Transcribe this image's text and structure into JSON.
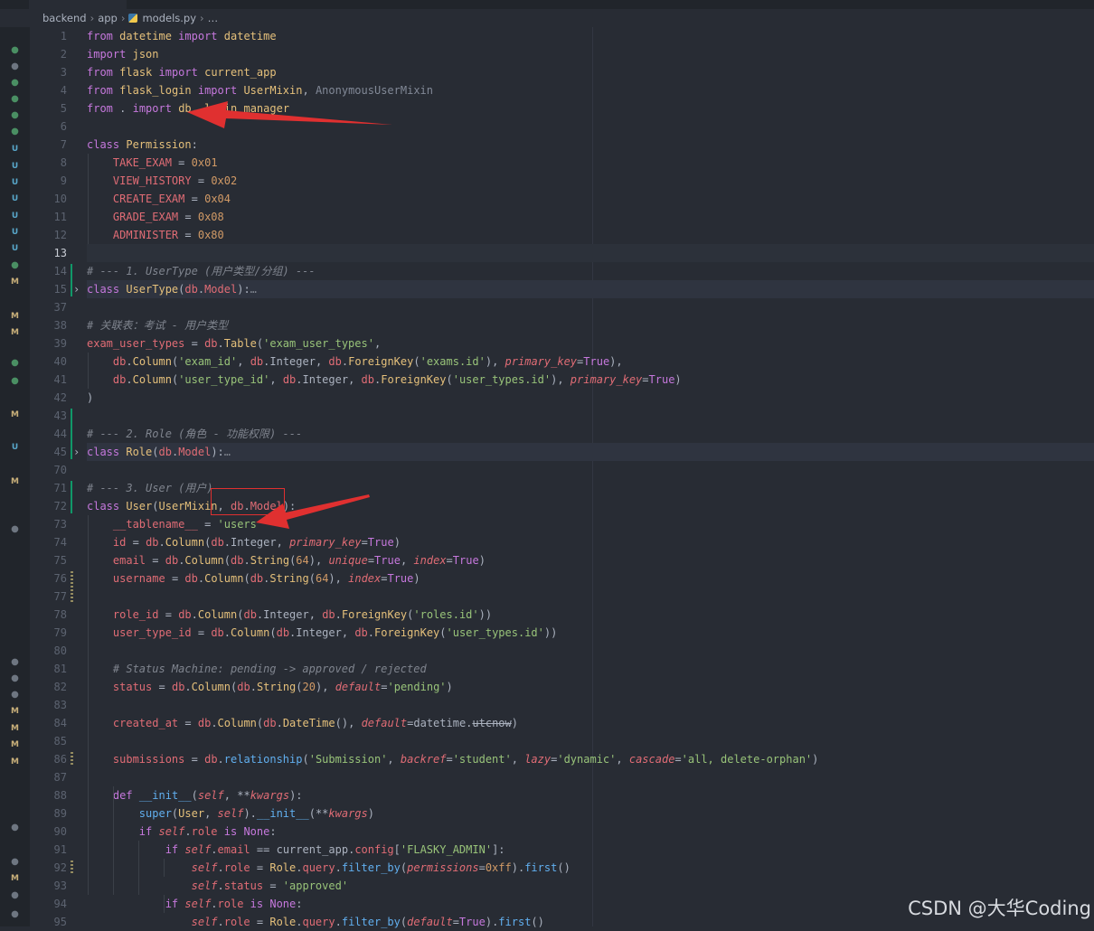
{
  "breadcrumb": {
    "parts": [
      "backend",
      "app",
      "models.py",
      "…"
    ]
  },
  "scm_markers": [
    {
      "text": "●",
      "color": "#4a8f63"
    },
    {
      "text": "●",
      "color": "#6e7681"
    },
    {
      "text": "●",
      "color": "#4a8f63"
    },
    {
      "text": "●",
      "color": "#4a8f63"
    },
    {
      "text": "●",
      "color": "#4a8f63"
    },
    {
      "text": "●",
      "color": "#4a8f63"
    },
    {
      "text": "U",
      "color": "#58a6c9"
    },
    {
      "text": "U",
      "color": "#58a6c9"
    },
    {
      "text": "U",
      "color": "#58a6c9"
    },
    {
      "text": "U",
      "color": "#58a6c9"
    },
    {
      "text": "U",
      "color": "#58a6c9"
    },
    {
      "text": "U",
      "color": "#58a6c9"
    },
    {
      "text": "U",
      "color": "#58a6c9"
    },
    {
      "text": "●",
      "color": "#4a8f63"
    },
    {
      "text": "M",
      "color": "#c9b07a"
    },
    {
      "text": "M",
      "color": "#c9b07a"
    },
    {
      "text": "M",
      "color": "#c9b07a"
    },
    {
      "text": "●",
      "color": "#4a8f63"
    },
    {
      "text": "●",
      "color": "#4a8f63"
    },
    {
      "text": "M",
      "color": "#c9b07a"
    },
    {
      "text": "U",
      "color": "#58a6c9"
    },
    {
      "text": "M",
      "color": "#c9b07a"
    },
    {
      "text": "●",
      "color": "#6e7681"
    },
    {
      "text": "●",
      "color": "#6e7681"
    },
    {
      "text": "●",
      "color": "#6e7681"
    },
    {
      "text": "●",
      "color": "#6e7681"
    },
    {
      "text": "M",
      "color": "#c9b07a"
    },
    {
      "text": "M",
      "color": "#c9b07a"
    },
    {
      "text": "M",
      "color": "#c9b07a"
    },
    {
      "text": "M",
      "color": "#c9b07a"
    },
    {
      "text": "●",
      "color": "#6e7681"
    },
    {
      "text": "●",
      "color": "#6e7681"
    },
    {
      "text": "M",
      "color": "#c9b07a"
    },
    {
      "text": "●",
      "color": "#6e7681"
    },
    {
      "text": "●",
      "color": "#6e7681"
    }
  ],
  "editor": {
    "current_line": "13",
    "lines": [
      {
        "n": "1",
        "code": "from datetime import datetime"
      },
      {
        "n": "2",
        "code": "import json"
      },
      {
        "n": "3",
        "code": "from flask import current_app"
      },
      {
        "n": "4",
        "code": "from flask_login import UserMixin, AnonymousUserMixin"
      },
      {
        "n": "5",
        "code": "from . import db, login_manager"
      },
      {
        "n": "6",
        "code": ""
      },
      {
        "n": "7",
        "code": "class Permission:"
      },
      {
        "n": "8",
        "code": "    TAKE_EXAM = 0x01"
      },
      {
        "n": "9",
        "code": "    VIEW_HISTORY = 0x02"
      },
      {
        "n": "10",
        "code": "    CREATE_EXAM = 0x04"
      },
      {
        "n": "11",
        "code": "    GRADE_EXAM = 0x08"
      },
      {
        "n": "12",
        "code": "    ADMINISTER = 0x80"
      },
      {
        "n": "13",
        "code": ""
      },
      {
        "n": "14",
        "code": "# --- 1. UserType (用户类型/分组) ---"
      },
      {
        "n": "15",
        "code": "class UserType(db.Model):…"
      },
      {
        "n": "37",
        "code": ""
      },
      {
        "n": "38",
        "code": "# 关联表：考试 - 用户类型"
      },
      {
        "n": "39",
        "code": "exam_user_types = db.Table('exam_user_types',"
      },
      {
        "n": "40",
        "code": "    db.Column('exam_id', db.Integer, db.ForeignKey('exams.id'), primary_key=True),"
      },
      {
        "n": "41",
        "code": "    db.Column('user_type_id', db.Integer, db.ForeignKey('user_types.id'), primary_key=True)"
      },
      {
        "n": "42",
        "code": ")"
      },
      {
        "n": "43",
        "code": ""
      },
      {
        "n": "44",
        "code": "# --- 2. Role (角色 - 功能权限) ---"
      },
      {
        "n": "45",
        "code": "class Role(db.Model):…"
      },
      {
        "n": "70",
        "code": ""
      },
      {
        "n": "71",
        "code": "# --- 3. User (用户) ---"
      },
      {
        "n": "72",
        "code": "class User(UserMixin, db.Model):"
      },
      {
        "n": "73",
        "code": "    __tablename__ = 'users'"
      },
      {
        "n": "74",
        "code": "    id = db.Column(db.Integer, primary_key=True)"
      },
      {
        "n": "75",
        "code": "    email = db.Column(db.String(64), unique=True, index=True)"
      },
      {
        "n": "76",
        "code": "    username = db.Column(db.String(64), index=True)"
      },
      {
        "n": "77",
        "code": ""
      },
      {
        "n": "78",
        "code": "    role_id = db.Column(db.Integer, db.ForeignKey('roles.id'))"
      },
      {
        "n": "79",
        "code": "    user_type_id = db.Column(db.Integer, db.ForeignKey('user_types.id'))"
      },
      {
        "n": "80",
        "code": ""
      },
      {
        "n": "81",
        "code": "    # Status Machine: pending -> approved / rejected"
      },
      {
        "n": "82",
        "code": "    status = db.Column(db.String(20), default='pending')"
      },
      {
        "n": "83",
        "code": ""
      },
      {
        "n": "84",
        "code": "    created_at = db.Column(db.DateTime(), default=datetime.utcnow)"
      },
      {
        "n": "85",
        "code": ""
      },
      {
        "n": "86",
        "code": "    submissions = db.relationship('Submission', backref='student', lazy='dynamic', cascade='all, delete-orphan')"
      },
      {
        "n": "87",
        "code": ""
      },
      {
        "n": "88",
        "code": "    def __init__(self, **kwargs):"
      },
      {
        "n": "89",
        "code": "        super(User, self).__init__(**kwargs)"
      },
      {
        "n": "90",
        "code": "        if self.role is None:"
      },
      {
        "n": "91",
        "code": "            if self.email == current_app.config['FLASKY_ADMIN']:"
      },
      {
        "n": "92",
        "code": "                self.role = Role.query.filter_by(permissions=0xff).first()"
      },
      {
        "n": "93",
        "code": "                self.status = 'approved'"
      },
      {
        "n": "94",
        "code": "            if self.role is None:"
      },
      {
        "n": "95",
        "code": "                self.role = Role.query.filter_by(default=True).first()"
      }
    ]
  },
  "watermark": "CSDN @大华Coding",
  "colors": {
    "editor_bg": "#282c34",
    "keyword": "#c678dd",
    "function": "#61afef",
    "class": "#e5c07b",
    "string": "#98c379",
    "number": "#d19a66",
    "comment": "#7f848e",
    "annotation_red": "#e03030"
  }
}
